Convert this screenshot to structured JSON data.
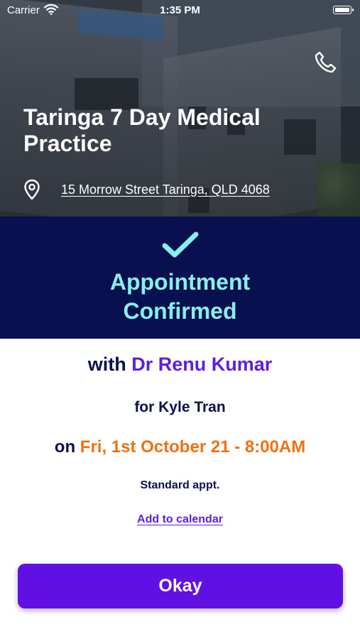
{
  "status_bar": {
    "carrier": "Carrier",
    "time": "1:35 PM",
    "wifi_icon": "wifi-icon",
    "battery_icon": "battery-icon"
  },
  "clinic": {
    "name": "Taringa 7 Day Medical Practice",
    "address": "15 Morrow Street Taringa, QLD 4068",
    "call_icon": "phone-icon",
    "location_icon": "map-pin-icon"
  },
  "confirmation": {
    "icon": "check-icon",
    "title": "Appointment Confirmed"
  },
  "appointment": {
    "with_prefix": "with",
    "doctor": "Dr Renu Kumar",
    "patient_line": "for Kyle Tran",
    "date_prefix": "on",
    "datetime": "Fri, 1st October 21 - 8:00AM",
    "type": "Standard appt.",
    "calendar_link": "Add to calendar"
  },
  "actions": {
    "okay_label": "Okay"
  },
  "colors": {
    "banner_bg": "#08104f",
    "confirm_text": "#86f0ec",
    "primary": "#6010e2",
    "doctor": "#5b1fe0",
    "datetime": "#f07112",
    "text_dark": "#0b1149"
  }
}
